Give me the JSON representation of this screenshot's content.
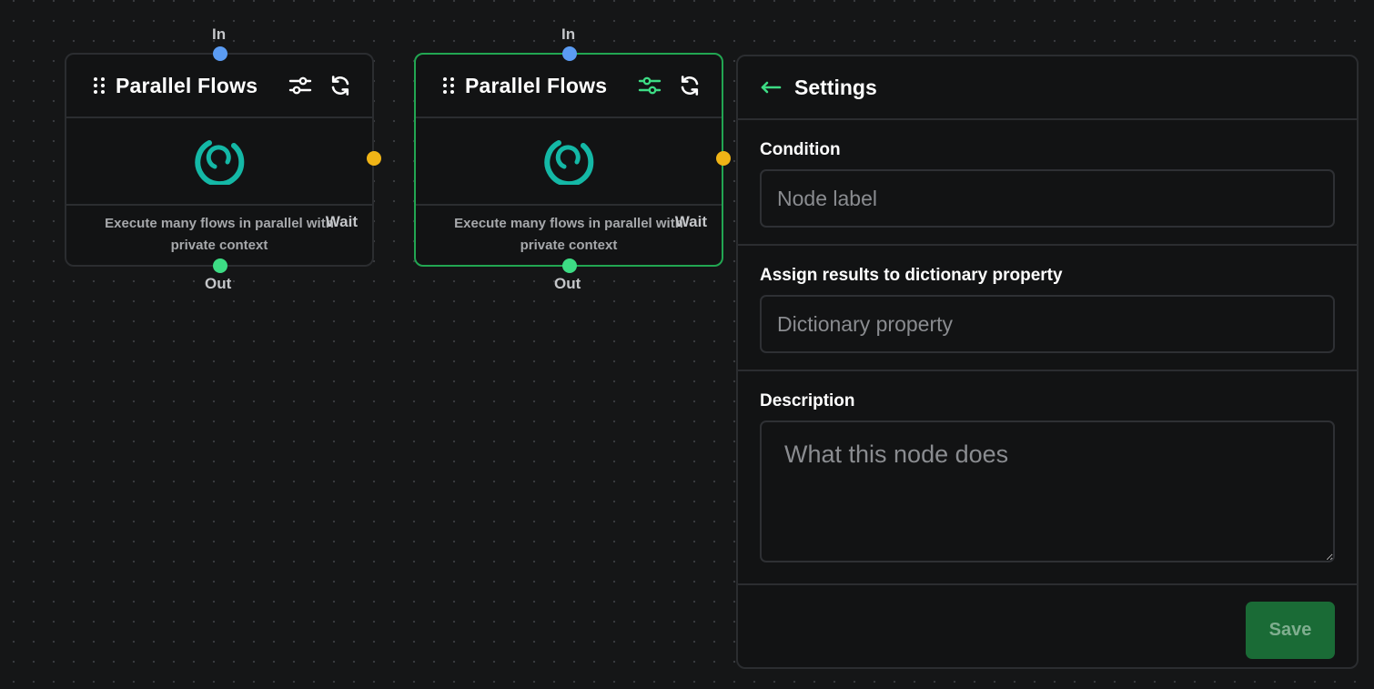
{
  "nodes": [
    {
      "title": "Parallel Flows",
      "description": "Execute many flows in parallel with private context",
      "ports": {
        "in": "In",
        "out": "Out",
        "wait": "Wait"
      },
      "selected": false
    },
    {
      "title": "Parallel Flows",
      "description": "Execute many flows in parallel with private context",
      "ports": {
        "in": "In",
        "out": "Out",
        "wait": "Wait"
      },
      "selected": true
    }
  ],
  "icons": {
    "drag": "drag-handle-icon",
    "settings": "sliders-icon",
    "refresh": "refresh-icon",
    "node": "parallel-flows-icon",
    "back": "arrow-left-icon"
  },
  "colors": {
    "accent_green": "#22a652",
    "icon_teal": "#14b8a6",
    "port_in": "#5b9cf3",
    "port_out": "#3ddc84",
    "port_wait": "#f0b416",
    "save_button": "#1a6b36"
  },
  "settings": {
    "title": "Settings",
    "fields": {
      "condition": {
        "label": "Condition",
        "placeholder": "Node label",
        "value": ""
      },
      "assign": {
        "label": "Assign results to dictionary property",
        "placeholder": "Dictionary property",
        "value": ""
      },
      "description": {
        "label": "Description",
        "placeholder": "What this node does",
        "value": ""
      }
    },
    "save_label": "Save"
  }
}
